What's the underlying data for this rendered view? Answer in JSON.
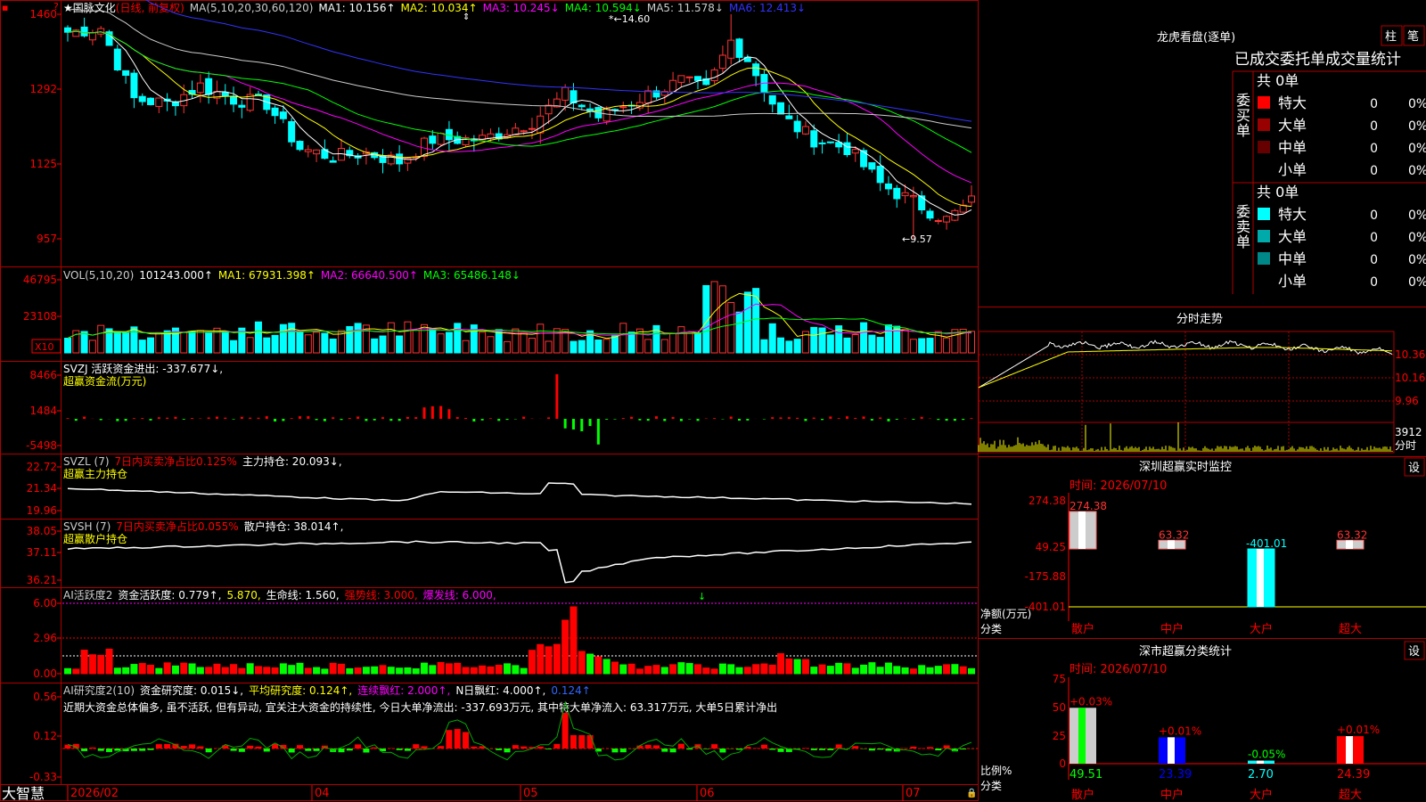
{
  "app": {
    "logo": "大智慧",
    "date_axis": [
      "2026/02",
      "04",
      "05",
      "06",
      "07"
    ]
  },
  "main": {
    "stock": "国脉文化",
    "mode": "(日线, 前复权)",
    "ma_title": "MA(5,10,20,30,60,120)",
    "ma_items": [
      {
        "label": "MA1: 10.156↑",
        "color": "#ffffff"
      },
      {
        "label": "MA2: 10.034↑",
        "color": "#ffff00"
      },
      {
        "label": "MA3: 10.245↓",
        "color": "#ff00ff"
      },
      {
        "label": "MA4: 10.594↓",
        "color": "#00ff00"
      },
      {
        "label": "MA5: 11.578↓",
        "color": "#cccccc"
      },
      {
        "label": "MA6: 12.413↓",
        "color": "#3333ff"
      }
    ],
    "y_ticks": [
      "1460",
      "1292",
      "1125",
      "957"
    ],
    "high_label": "14.60",
    "low_label": "9.57"
  },
  "vol": {
    "title": "VOL(5,10,20)",
    "items": [
      {
        "label": "101243.000↑",
        "color": "#ffffff"
      },
      {
        "label": "MA1: 67931.398↑",
        "color": "#ffff00"
      },
      {
        "label": "MA2: 66640.500↑",
        "color": "#ff00ff"
      },
      {
        "label": "MA3: 65486.148↓",
        "color": "#00ff00"
      }
    ],
    "y_ticks": [
      "46795",
      "23108"
    ],
    "unit": "X10"
  },
  "svzj": {
    "line1": "SVZJ  活跃资金进出: -337.677↓,",
    "line2": "超赢资金流(万元)",
    "y_ticks": [
      "8466",
      "1484",
      "-5498"
    ]
  },
  "svzl": {
    "prefix": "SVZL (7)",
    "red": "7日内买卖净占比0.125%",
    "rest": "主力持仓: 20.093↓,",
    "line2": "超赢主力持仓",
    "y_ticks": [
      "22.72",
      "21.34",
      "19.96"
    ]
  },
  "svsh": {
    "prefix": "SVSH (7)",
    "red": "7日内买卖净占比0.055%",
    "rest": "散户持仓: 38.014↑,",
    "line2": "超赢散户持仓",
    "y_ticks": [
      "38.05",
      "37.11",
      "36.21"
    ]
  },
  "ai_act": {
    "title": "AI活跃度2",
    "items": [
      {
        "label": "资金活跃度: 0.779↑,",
        "color": "#ffffff"
      },
      {
        "label": "5.870,",
        "color": "#ffff00"
      },
      {
        "label": "生命线: 1.560,",
        "color": "#ffffff"
      },
      {
        "label": "强势线: 3.000,",
        "color": "#ff0000"
      },
      {
        "label": "爆发线: 6.000,",
        "color": "#ff00ff"
      }
    ],
    "y_ticks": [
      "6.00",
      "2.96",
      "0.00"
    ]
  },
  "ai_res": {
    "title": "AI研究度2(10)",
    "items": [
      {
        "label": "资金研究度: 0.015↓,",
        "color": "#ffffff"
      },
      {
        "label": "平均研究度: 0.124↑,",
        "color": "#ffff00"
      },
      {
        "label": "连续飘红: 2.000↑,",
        "color": "#ff00ff"
      },
      {
        "label": "N日飘红: 4.000↑,",
        "color": "#ffffff"
      },
      {
        "label": "0.124↑",
        "color": "#3366ff"
      }
    ],
    "comment": "近期大资金总体偏多, 虽不活跃, 但有异动, 宜关注大资金的持续性, 今日大单净流出: -337.693万元, 其中特大单净流入: 63.317万元, 大单5日累计净出",
    "y_ticks": [
      "0.56",
      "0.12",
      "-0.33"
    ]
  },
  "right": {
    "lhb_title": "龙虎看盘(逐单)",
    "btn_zhu": "柱",
    "btn_bi": "笔",
    "stat_title": "已成交委托单成交量统计",
    "buy_label": "委买单",
    "sell_label": "委卖单",
    "buy_total": "共 0单",
    "sell_total": "共 0单",
    "buy_rows": [
      {
        "name": "特大",
        "num": "0",
        "pct": "0%",
        "color": "#ff0000"
      },
      {
        "name": "大单",
        "num": "0",
        "pct": "0%",
        "color": "#990000"
      },
      {
        "name": "中单",
        "num": "0",
        "pct": "0%",
        "color": "#660000"
      },
      {
        "name": "小单",
        "num": "0",
        "pct": "0%",
        "color": ""
      }
    ],
    "sell_rows": [
      {
        "name": "特大",
        "num": "0",
        "pct": "0%",
        "color": "#00ffff"
      },
      {
        "name": "大单",
        "num": "0",
        "pct": "0%",
        "color": "#00aaaa"
      },
      {
        "name": "中单",
        "num": "0",
        "pct": "0%",
        "color": "#008888"
      },
      {
        "name": "小单",
        "num": "0",
        "pct": "0%",
        "color": ""
      }
    ],
    "intraday_title": "分时走势",
    "intraday_y": [
      "10.36",
      "10.16",
      "9.96"
    ],
    "intraday_vol": "3912",
    "intraday_vol2": "分时",
    "monitor_title": "深圳超赢实时监控",
    "set_label": "设",
    "monitor_time": "时间: 2026/07/10",
    "monitor_y": [
      "274.38",
      "49.25",
      "-175.88",
      "-401.01"
    ],
    "monitor_unit": "净额(万元)",
    "monitor_cat": "分类",
    "class_title": "深市超赢分类统计",
    "class_time": "时间: 2026/07/10",
    "class_y": [
      "75",
      "50",
      "25",
      "0"
    ],
    "class_unit": "比例%",
    "class_cat": "分类"
  },
  "chart_data": [
    {
      "type": "candlestick",
      "name": "国脉文化 日线",
      "x": [
        "2026/02",
        "04",
        "05",
        "06",
        "07"
      ],
      "price_ticks": [
        14.6,
        12.92,
        11.25,
        9.57
      ],
      "high": 14.6,
      "low": 9.57,
      "ma": {
        "MA1": 10.156,
        "MA2": 10.034,
        "MA3": 10.245,
        "MA4": 10.594,
        "MA5": 11.578,
        "MA6": 12.413
      }
    },
    {
      "type": "bar",
      "name": "VOL",
      "value": 101243.0,
      "ma": [
        67931.398,
        66640.5,
        65486.148
      ],
      "y_ticks": [
        46795,
        23108
      ]
    },
    {
      "type": "bar",
      "name": "深圳超赢实时监控",
      "categories": [
        "散户",
        "中户",
        "大户",
        "超大"
      ],
      "values": [
        274.38,
        63.32,
        -401.01,
        63.32
      ],
      "ylim": [
        -401.01,
        274.38
      ]
    },
    {
      "type": "bar",
      "name": "深市超赢分类统计",
      "categories": [
        "散户",
        "中户",
        "大户",
        "超大"
      ],
      "values": [
        49.51,
        23.39,
        2.7,
        24.39
      ],
      "changes": [
        "+0.03%",
        "+0.01%",
        "-0.05%",
        "+0.01%"
      ],
      "ylim": [
        0,
        75
      ]
    }
  ]
}
